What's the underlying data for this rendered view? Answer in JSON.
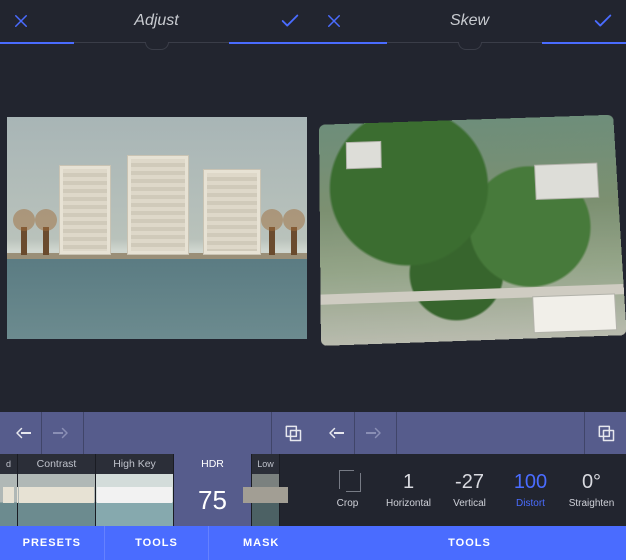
{
  "left": {
    "header": {
      "title": "Adjust"
    },
    "nav": {
      "back_enabled": true,
      "forward_enabled": false
    },
    "filters": [
      {
        "key": "vivid_partial_left",
        "label": "d"
      },
      {
        "key": "contrast",
        "label": "Contrast"
      },
      {
        "key": "highkey",
        "label": "High Key"
      },
      {
        "key": "hdr",
        "label": "HDR",
        "value": "75",
        "active": true
      },
      {
        "key": "low_partial_right",
        "label": "Low"
      }
    ],
    "tabs": [
      {
        "key": "presets",
        "label": "PRESETS",
        "active": true
      },
      {
        "key": "tools",
        "label": "TOOLS"
      },
      {
        "key": "mask",
        "label": "MASK"
      }
    ]
  },
  "right": {
    "header": {
      "title": "Skew"
    },
    "nav": {
      "back_enabled": true,
      "forward_enabled": false
    },
    "params": [
      {
        "key": "crop",
        "label": "Crop",
        "value": "",
        "icon": true
      },
      {
        "key": "horizontal",
        "label": "Horizontal",
        "value": "1"
      },
      {
        "key": "vertical",
        "label": "Vertical",
        "value": "-27"
      },
      {
        "key": "distort",
        "label": "Distort",
        "value": "100",
        "active": true
      },
      {
        "key": "straighten",
        "label": "Straighten",
        "value": "0°"
      }
    ],
    "tabs": [
      {
        "key": "tools",
        "label": "TOOLS",
        "active": true
      }
    ]
  },
  "colors": {
    "accent": "#4a6cff",
    "panel": "#565c8c",
    "bg": "#22252f"
  }
}
